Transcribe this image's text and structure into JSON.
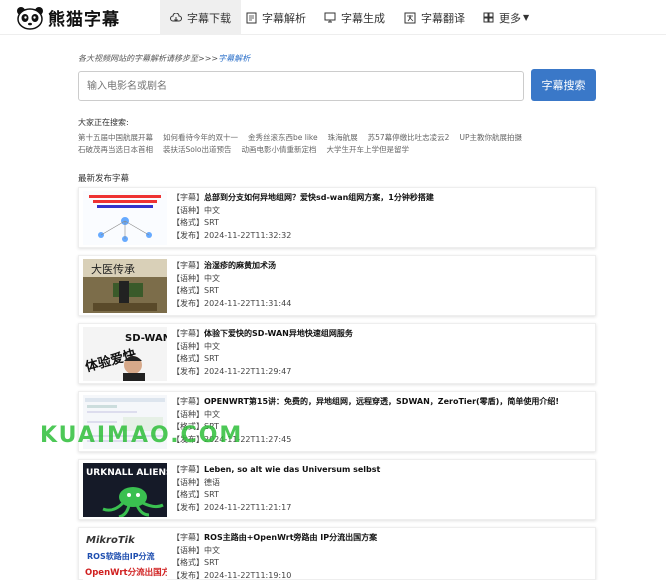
{
  "nav": {
    "logo_text": "熊猫字幕",
    "tabs": [
      {
        "label": "字幕下载",
        "icon": "cloud-download-icon"
      },
      {
        "label": "字幕解析",
        "icon": "document-icon"
      },
      {
        "label": "字幕生成",
        "icon": "monitor-icon"
      },
      {
        "label": "字幕翻译",
        "icon": "translate-icon"
      },
      {
        "label": "更多",
        "icon": "grid-icon"
      }
    ]
  },
  "breadcrumb": {
    "text": "各大视频网站的字幕解析请移步至>>>",
    "link": "字幕解析"
  },
  "search": {
    "placeholder": "输入电影名或剧名",
    "button": "字幕搜索"
  },
  "hot": {
    "title": "大家正在搜索:",
    "items": [
      "第十五届中国航展开幕",
      "如何看待今年的双十一",
      "金秀丝滚东西be like",
      "珠海航展",
      "苏57幕停缴比吐志凌云2",
      "UP主教你航展拍摄",
      "石破茂再当选日本首相",
      "装扶活Solo出道预告",
      "动画电影小倩重新定档",
      "大学生开车上学但是留学"
    ]
  },
  "latest": {
    "title": "最新发布字幕"
  },
  "labels": {
    "tag": "【字幕】",
    "lang": "【语种】",
    "fmt": "【格式】",
    "pub": "【发布】"
  },
  "items": [
    {
      "title": "总部到分支如何异地组网？爱快sd-wan组网方案，1分钟秒搭建",
      "lang": "中文",
      "format": "SRT",
      "date": "2024-11-22T11:32:32"
    },
    {
      "title": "治湿疹的麻黄加术汤",
      "lang": "中文",
      "format": "SRT",
      "date": "2024-11-22T11:31:44"
    },
    {
      "title": "体验下爱快的SD-WAN异地快速组网服务",
      "lang": "中文",
      "format": "SRT",
      "date": "2024-11-22T11:29:47"
    },
    {
      "title": "OPENWRT第15讲：免费的，异地组网，远程穿透，SDWAN，ZeroTier(零盾)，简单使用介绍!",
      "lang": "中文",
      "format": "SRT",
      "date": "2024-11-22T11:27:45"
    },
    {
      "title": "Leben, so alt wie das Universum selbst",
      "lang": "德语",
      "format": "SRT",
      "date": "2024-11-22T11:21:17"
    },
    {
      "title": "ROS主路由+OpenWrt旁路由 IP分流出国方案",
      "lang": "中文",
      "format": "SRT",
      "date": "2024-11-22T11:19:10"
    }
  ],
  "thumbs": {
    "t2": "大医传承",
    "t3_a": "SD-WAN",
    "t3_b": "体验爱快",
    "t5": "URKNALL ALIENS",
    "t6_brand": "MikroTik",
    "t6_a": "ROS软路由IP分流",
    "t6_b": "OpenWrt分流出国方案"
  },
  "watermark": "KUAIMAO.COM"
}
